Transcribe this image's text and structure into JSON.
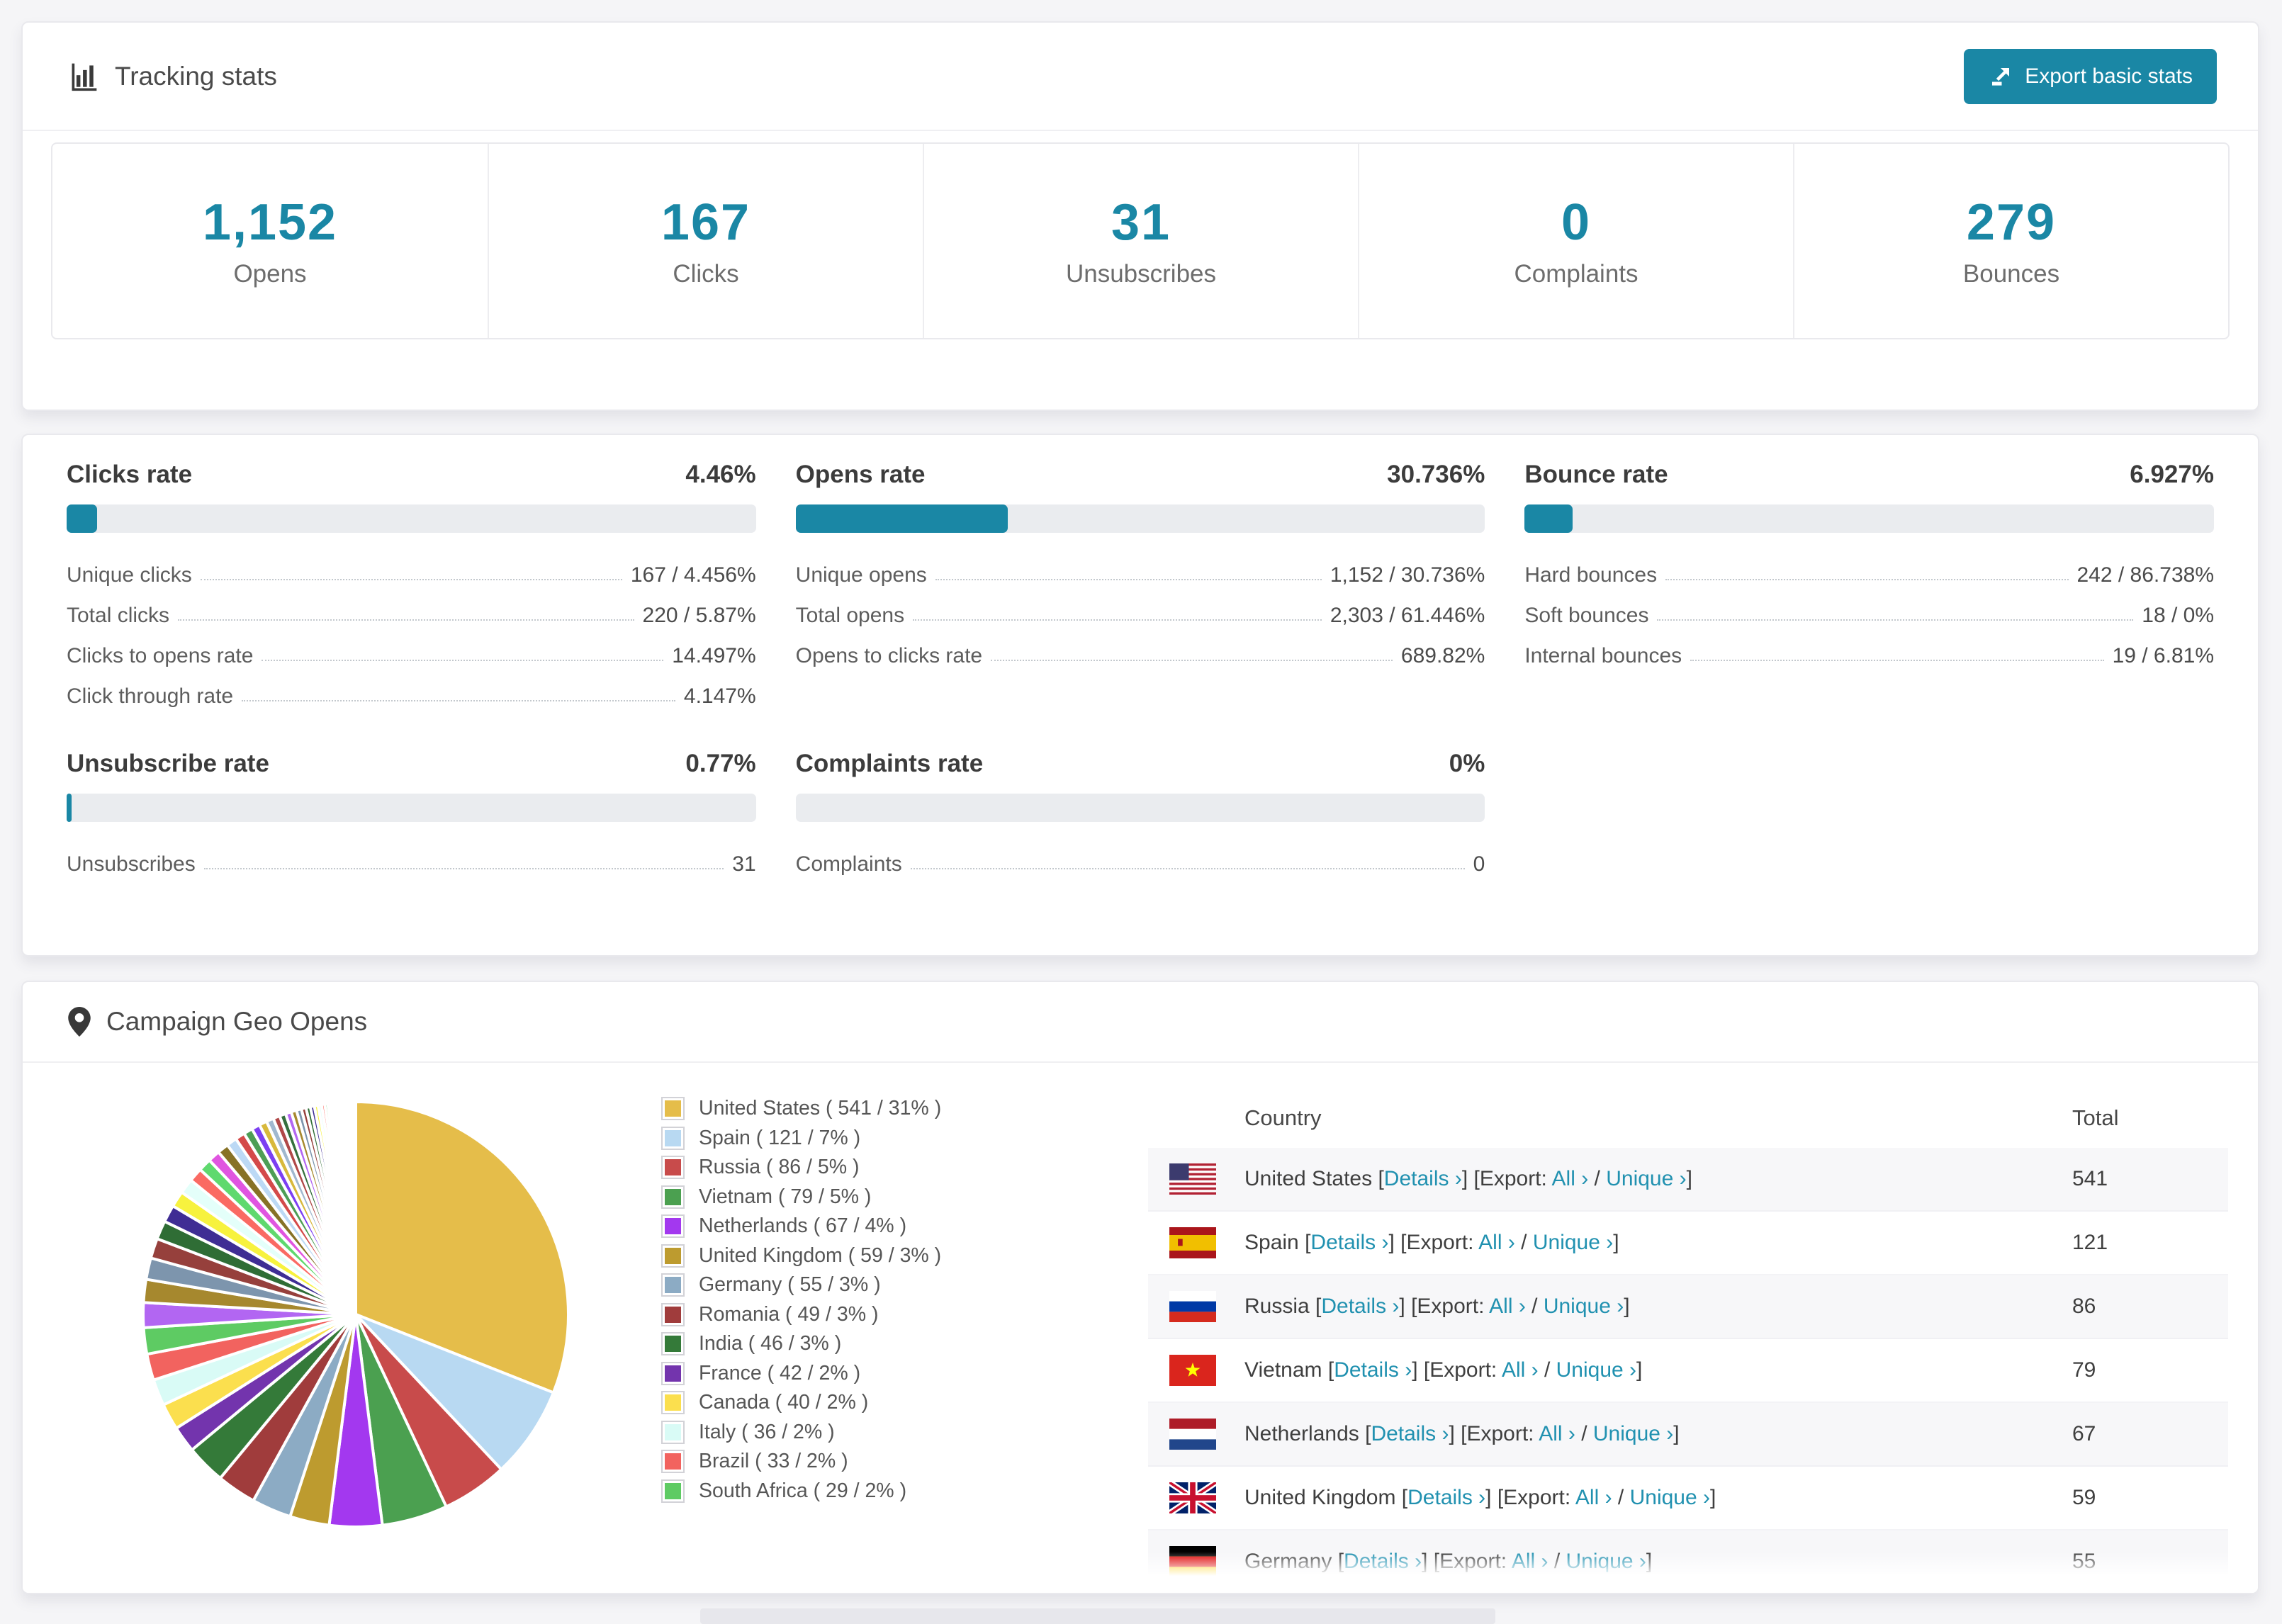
{
  "theme": {
    "accent": "#1a87a5",
    "link_color": "#2191b0",
    "progress_track": "#eaecef",
    "page_background": "#f5f5f7"
  },
  "tracking": {
    "title": "Tracking stats",
    "export_button": {
      "label": "Export basic stats",
      "icon": "export-icon"
    },
    "stats": [
      {
        "value": "1,152",
        "label": "Opens"
      },
      {
        "value": "167",
        "label": "Clicks"
      },
      {
        "value": "31",
        "label": "Unsubscribes"
      },
      {
        "value": "0",
        "label": "Complaints"
      },
      {
        "value": "279",
        "label": "Bounces"
      }
    ]
  },
  "rates": [
    {
      "title": "Clicks rate",
      "value": "4.46%",
      "percent": 4.46,
      "rows": [
        {
          "label": "Unique clicks",
          "value": "167 / 4.456%"
        },
        {
          "label": "Total clicks",
          "value": "220 / 5.87%"
        },
        {
          "label": "Clicks to opens rate",
          "value": "14.497%"
        },
        {
          "label": "Click through rate",
          "value": "4.147%"
        }
      ]
    },
    {
      "title": "Opens rate",
      "value": "30.736%",
      "percent": 30.736,
      "rows": [
        {
          "label": "Unique opens",
          "value": "1,152 / 30.736%"
        },
        {
          "label": "Total opens",
          "value": "2,303 / 61.446%"
        },
        {
          "label": "Opens to clicks rate",
          "value": "689.82%"
        }
      ]
    },
    {
      "title": "Bounce rate",
      "value": "6.927%",
      "percent": 6.927,
      "rows": [
        {
          "label": "Hard bounces",
          "value": "242 / 86.738%"
        },
        {
          "label": "Soft bounces",
          "value": "18 / 0%"
        },
        {
          "label": "Internal bounces",
          "value": "19 / 6.81%"
        }
      ]
    },
    {
      "title": "Unsubscribe rate",
      "value": "0.77%",
      "percent": 0.77,
      "rows": [
        {
          "label": "Unsubscribes",
          "value": "31"
        }
      ]
    },
    {
      "title": "Complaints rate",
      "value": "0%",
      "percent": 0,
      "rows": [
        {
          "label": "Complaints",
          "value": "0"
        }
      ]
    }
  ],
  "geo": {
    "title": "Campaign Geo Opens",
    "legend_format": "{country} ( {count} / {pct}% )",
    "table": {
      "headers": [
        "Country",
        "Total"
      ],
      "links": {
        "details": "Details ›",
        "export_prefix": "Export:",
        "all": "All ›",
        "unique": "Unique ›"
      },
      "rows": [
        {
          "country": "United States",
          "flag": "us",
          "total": "541"
        },
        {
          "country": "Spain",
          "flag": "es",
          "total": "121"
        },
        {
          "country": "Russia",
          "flag": "ru",
          "total": "86"
        },
        {
          "country": "Vietnam",
          "flag": "vn",
          "total": "79"
        },
        {
          "country": "Netherlands",
          "flag": "nl",
          "total": "67"
        },
        {
          "country": "United Kingdom",
          "flag": "gb",
          "total": "59"
        },
        {
          "country": "Germany",
          "flag": "de",
          "total": "55"
        }
      ]
    }
  },
  "chart_data": {
    "type": "pie",
    "title": "Campaign Geo Opens",
    "legend_position": "right",
    "start_angle_deg": -90,
    "direction": "clockwise",
    "slice_stroke": "#ffffff",
    "series": [
      {
        "name": "United States",
        "count": 541,
        "percent": 31,
        "color": "#e5bd4a"
      },
      {
        "name": "Spain",
        "count": 121,
        "percent": 7,
        "color": "#b8d9f2"
      },
      {
        "name": "Russia",
        "count": 86,
        "percent": 5,
        "color": "#c84b4b"
      },
      {
        "name": "Vietnam",
        "count": 79,
        "percent": 5,
        "color": "#4ba050"
      },
      {
        "name": "Netherlands",
        "count": 67,
        "percent": 4,
        "color": "#a338ef"
      },
      {
        "name": "United Kingdom",
        "count": 59,
        "percent": 3,
        "color": "#bd9b2f"
      },
      {
        "name": "Germany",
        "count": 55,
        "percent": 3,
        "color": "#8cabc4"
      },
      {
        "name": "Romania",
        "count": 49,
        "percent": 3,
        "color": "#a03c3c"
      },
      {
        "name": "India",
        "count": 46,
        "percent": 3,
        "color": "#347a39"
      },
      {
        "name": "France",
        "count": 42,
        "percent": 2,
        "color": "#7334ad"
      },
      {
        "name": "Canada",
        "count": 40,
        "percent": 2,
        "color": "#fbdf4e"
      },
      {
        "name": "Italy",
        "count": 36,
        "percent": 2,
        "color": "#d9fbf6"
      },
      {
        "name": "Brazil",
        "count": 33,
        "percent": 2,
        "color": "#f2635f"
      },
      {
        "name": "South Africa",
        "count": 29,
        "percent": 2,
        "color": "#5ecb63"
      }
    ],
    "others": {
      "description": "many small unlabeled country slices tapering to slivers",
      "total_percent": 26,
      "count": 46,
      "decay": 0.93,
      "palette": [
        "#b266f2",
        "#a6882e",
        "#7d95ad",
        "#96403c",
        "#2f6d35",
        "#3f2d94",
        "#f7f23e",
        "#e4fffa",
        "#fa6a63",
        "#5fd96e",
        "#e055e0",
        "#877226",
        "#bcd9f5",
        "#d44a4a",
        "#4e9e55",
        "#7c3ff2",
        "#d8b93c",
        "#a0b8cf",
        "#b04848",
        "#356f3e"
      ]
    }
  }
}
